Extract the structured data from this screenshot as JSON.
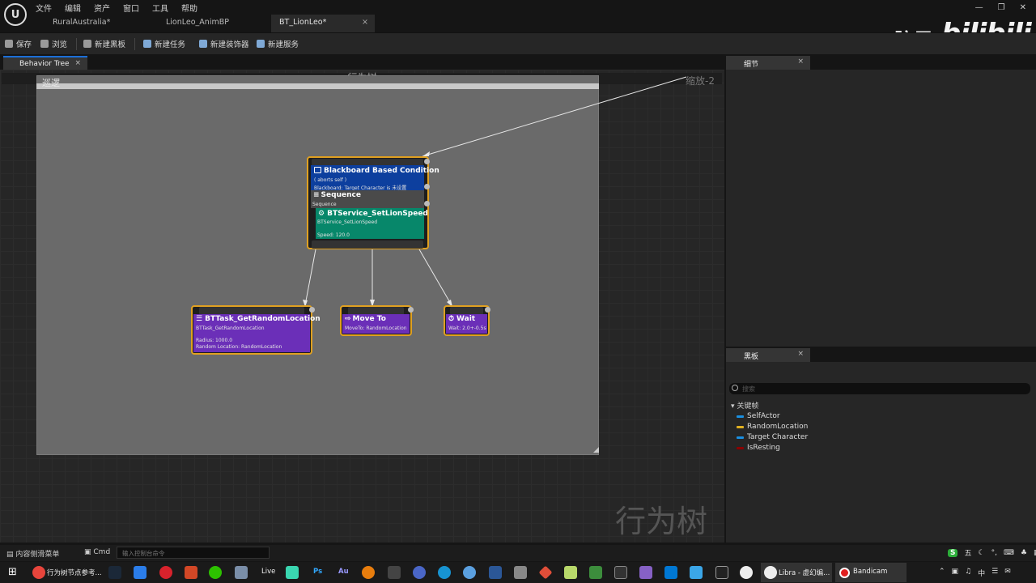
{
  "menu": [
    "文件",
    "编辑",
    "资产",
    "窗口",
    "工具",
    "帮助"
  ],
  "tabs": [
    {
      "label": "RuralAustralia*"
    },
    {
      "label": "LionLeo_AnimBP"
    },
    {
      "label": "BT_LionLeo*",
      "close": "×"
    }
  ],
  "watermark": {
    "left": "tt脑思",
    "right": "bilibili"
  },
  "toolbar": {
    "save": "保存",
    "browse": "浏览",
    "new_blackboard": "新建黑板",
    "new_task": "新建任务",
    "new_decorator": "新建装饰器",
    "new_service": "新建服务"
  },
  "graph_panel": {
    "tab_label": "Behavior Tree",
    "tab_close": "×",
    "title": "行为树",
    "zoom_label": "缩放-2",
    "comment": "巡逻",
    "watermark": "行为树"
  },
  "nodes": {
    "root": {
      "decorator_title": "Blackboard Based Condition",
      "decorator_sub1": "( aborts self )",
      "decorator_sub2": "Blackboard: Target Character is 未设置",
      "composite_title": "Sequence",
      "composite_sub": "Sequence",
      "service_title": "BTService_SetLionSpeed",
      "service_sub": "BTService_SetLionSpeed",
      "service_param": "Speed: 120.0"
    },
    "task1": {
      "title": "BTTask_GetRandomLocation",
      "sub": "BTTask_GetRandomLocation",
      "param1": "Radius: 1000.0",
      "param2": "Random Location: RandomLocation"
    },
    "task2": {
      "title": "Move To",
      "sub": "MoveTo: RandomLocation"
    },
    "task3": {
      "title": "Wait",
      "sub": "Wait: 2.0+-0.5s"
    }
  },
  "details": {
    "tab_label": "细节",
    "close": "×"
  },
  "blackboard": {
    "tab_label": "黑板",
    "close": "×",
    "search_placeholder": "搜索",
    "group": "关键帧",
    "keys": [
      {
        "name": "SelfActor",
        "color": "#1a8fe0"
      },
      {
        "name": "RandomLocation",
        "color": "#e0b020"
      },
      {
        "name": "Target Character",
        "color": "#1a8fe0"
      },
      {
        "name": "IsResting",
        "color": "#8b0000"
      }
    ]
  },
  "statusbar": {
    "content_menu": "内容侧滑菜单",
    "cmd": "Cmd",
    "console_placeholder": "输入控制台命令"
  },
  "taskbar": {
    "chrome_label": "行为树节点参考...",
    "libra_label": "Libra - 虚幻编...",
    "bandicam_label": "Bandicam",
    "live": "Live",
    "ps": "Ps",
    "au": "Au"
  },
  "ime": {
    "logo": "S",
    "mode": "五"
  },
  "tray": {
    "lang": "中"
  }
}
